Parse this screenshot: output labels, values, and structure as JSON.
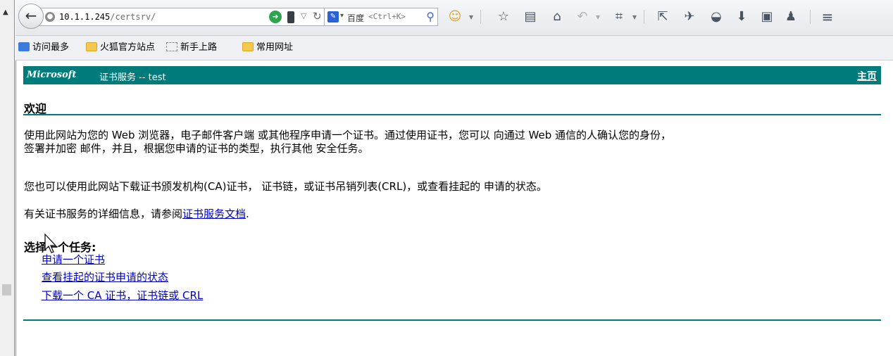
{
  "browser": {
    "url_host": "10.1.1.245",
    "url_path": "/certsrv/",
    "search_engine": "百度",
    "search_placeholder": "<Ctrl+K>"
  },
  "bookmarks": [
    {
      "label": "访问最多",
      "icon": "search-icon"
    },
    {
      "label": "火狐官方站点",
      "icon": "folder-icon"
    },
    {
      "label": "新手上路",
      "icon": "dashed-page-icon"
    },
    {
      "label": "常用网址",
      "icon": "folder-icon"
    }
  ],
  "page": {
    "logo": "Microsoft",
    "service_title": "证书服务 --  test",
    "home_link": "主页",
    "welcome": "欢迎",
    "para1_line1": "使用此网站为您的 Web 浏览器，电子邮件客户端 或其他程序申请一个证书。通过使用证书，您可以 向通过 Web 通信的人确认您的身份，",
    "para1_line2": "签署并加密 邮件，并且，根据您申请的证书的类型，执行其他 安全任务。",
    "para2": "您也可以使用此网站下载证书颁发机构(CA)证书， 证书链，或证书吊销列表(CRL)，或查看挂起的 申请的状态。",
    "para3_prefix": "有关证书服务的详细信息，请参阅",
    "para3_link": "证书服务文档",
    "para3_suffix": ".",
    "task_title": "选择一个任务:",
    "tasks": [
      "申请一个证书",
      "查看挂起的证书申请的状态",
      "下载一个 CA 证书，证书链或 CRL"
    ]
  },
  "colors": {
    "header_teal": "#007b7b",
    "link_blue": "#0000cc"
  }
}
